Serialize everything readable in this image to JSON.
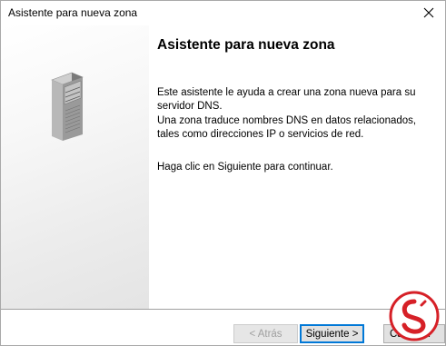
{
  "window": {
    "title": "Asistente para nueva zona"
  },
  "content": {
    "heading": "Asistente para nueva zona",
    "paragraph1": "Este asistente le ayuda a crear una zona nueva para su servidor DNS.",
    "paragraph2": "Una zona traduce nombres DNS en datos relacionados, tales como direcciones IP o servicios de red.",
    "paragraph3": "Haga clic en Siguiente para continuar."
  },
  "buttons": {
    "back": "< Atrás",
    "next": "Siguiente >",
    "cancel": "Cancelar"
  },
  "icons": {
    "close": "close-icon",
    "server": "server-icon",
    "watermark": "watermark-logo"
  },
  "colors": {
    "default_button_border": "#0078d7",
    "button_face": "#e1e1e1",
    "watermark_red": "#d62027"
  }
}
